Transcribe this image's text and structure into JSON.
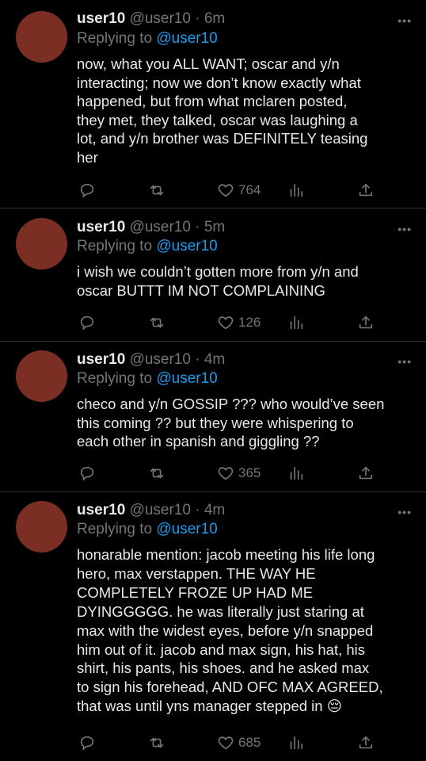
{
  "tweets": [
    {
      "name": "user10",
      "handle": "@user10",
      "dot": "·",
      "time": "6m",
      "replying_prefix": "Replying to ",
      "replying_to": "@user10",
      "more": "•••",
      "text": "now, what you ALL WANT; oscar and y/n\ninteracting; now we don’t know exactly what\nhappened, but from what mclaren posted,\nthey met, they talked, oscar was laughing a\nlot, and y/n brother was DEFINITELY teasing\nher",
      "likes": "764"
    },
    {
      "name": "user10",
      "handle": "@user10",
      "dot": "·",
      "time": "5m",
      "replying_prefix": "Replying to ",
      "replying_to": "@user10",
      "more": "•••",
      "text": "i wish we couldn’t gotten more from y/n and\noscar BUTTT IM NOT COMPLAINING",
      "likes": "126"
    },
    {
      "name": "user10",
      "handle": "@user10",
      "dot": "·",
      "time": "4m",
      "replying_prefix": "Replying to ",
      "replying_to": "@user10",
      "more": "•••",
      "text": "checo and y/n GOSSIP ??? who would’ve seen\nthis coming ?? but they were whispering to\neach other in spanish and giggling ??",
      "likes": "365"
    },
    {
      "name": "user10",
      "handle": "@user10",
      "dot": "·",
      "time": "4m",
      "replying_prefix": "Replying to ",
      "replying_to": "@user10",
      "more": "•••",
      "text": "honarable mention: jacob meeting his life long\nhero, max verstappen. THE WAY HE\nCOMPLETELY FROZE UP HAD ME\nDYINGGGGG. he was literally just staring at\nmax with the widest eyes, before y/n snapped\nhim out of it. jacob and max sign, his hat, his\nshirt, his pants, his shoes. and he asked max\nto sign his forehead, AND OFC MAX AGREED,\nthat was until yns manager stepped in 😔",
      "likes": "685"
    }
  ],
  "colors": {
    "background": "#000000",
    "text": "#e7e9ea",
    "muted": "#71767b",
    "link": "#1d9bf0",
    "avatar": "#7a2e24",
    "divider": "#2f3336"
  },
  "icons": [
    "reply-icon",
    "retweet-icon",
    "like-icon",
    "analytics-icon",
    "share-icon",
    "more-icon"
  ]
}
